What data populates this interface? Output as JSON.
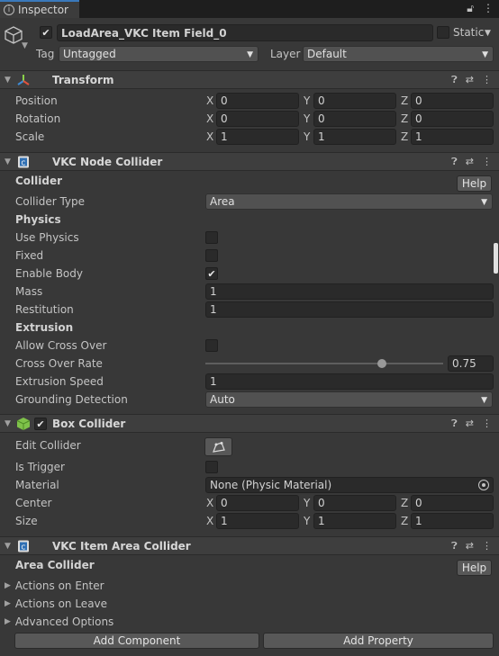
{
  "tab": {
    "label": "Inspector"
  },
  "object": {
    "name": "LoadArea_VKC Item Field_0",
    "static_label": "Static",
    "tag_label": "Tag",
    "tag_value": "Untagged",
    "layer_label": "Layer",
    "layer_value": "Default"
  },
  "transform": {
    "title": "Transform",
    "rows": [
      {
        "label": "Position",
        "x": "0",
        "y": "0",
        "z": "0"
      },
      {
        "label": "Rotation",
        "x": "0",
        "y": "0",
        "z": "0"
      },
      {
        "label": "Scale",
        "x": "1",
        "y": "1",
        "z": "1"
      }
    ]
  },
  "axes": {
    "x": "X",
    "y": "Y",
    "z": "Z"
  },
  "node_collider": {
    "title": "VKC Node Collider",
    "section_collider": "Collider",
    "help": "Help",
    "collider_type_label": "Collider Type",
    "collider_type_value": "Area",
    "section_physics": "Physics",
    "use_physics": "Use Physics",
    "fixed": "Fixed",
    "enable_body": "Enable Body",
    "mass_label": "Mass",
    "mass_value": "1",
    "restitution_label": "Restitution",
    "restitution_value": "1",
    "section_extrusion": "Extrusion",
    "allow_cross_over": "Allow Cross Over",
    "cross_over_rate_label": "Cross Over Rate",
    "cross_over_rate_value": "0.75",
    "cross_over_rate_fraction": 0.75,
    "extrusion_speed_label": "Extrusion Speed",
    "extrusion_speed_value": "1",
    "grounding_label": "Grounding Detection",
    "grounding_value": "Auto"
  },
  "box_collider": {
    "title": "Box Collider",
    "edit_collider": "Edit Collider",
    "is_trigger": "Is Trigger",
    "material_label": "Material",
    "material_value": "None (Physic Material)",
    "center": {
      "label": "Center",
      "x": "0",
      "y": "0",
      "z": "0"
    },
    "size": {
      "label": "Size",
      "x": "1",
      "y": "1",
      "z": "1"
    }
  },
  "area_collider": {
    "title": "VKC Item Area Collider",
    "section": "Area Collider",
    "help": "Help",
    "foldouts": [
      "Actions on Enter",
      "Actions on Leave",
      "Advanced Options"
    ]
  },
  "footer": {
    "add_component": "Add Component",
    "add_property": "Add Property"
  },
  "colors": {
    "background": "#383838",
    "header": "#3e3e3e",
    "field": "#2a2a2a",
    "accent": "#3a79bb"
  }
}
